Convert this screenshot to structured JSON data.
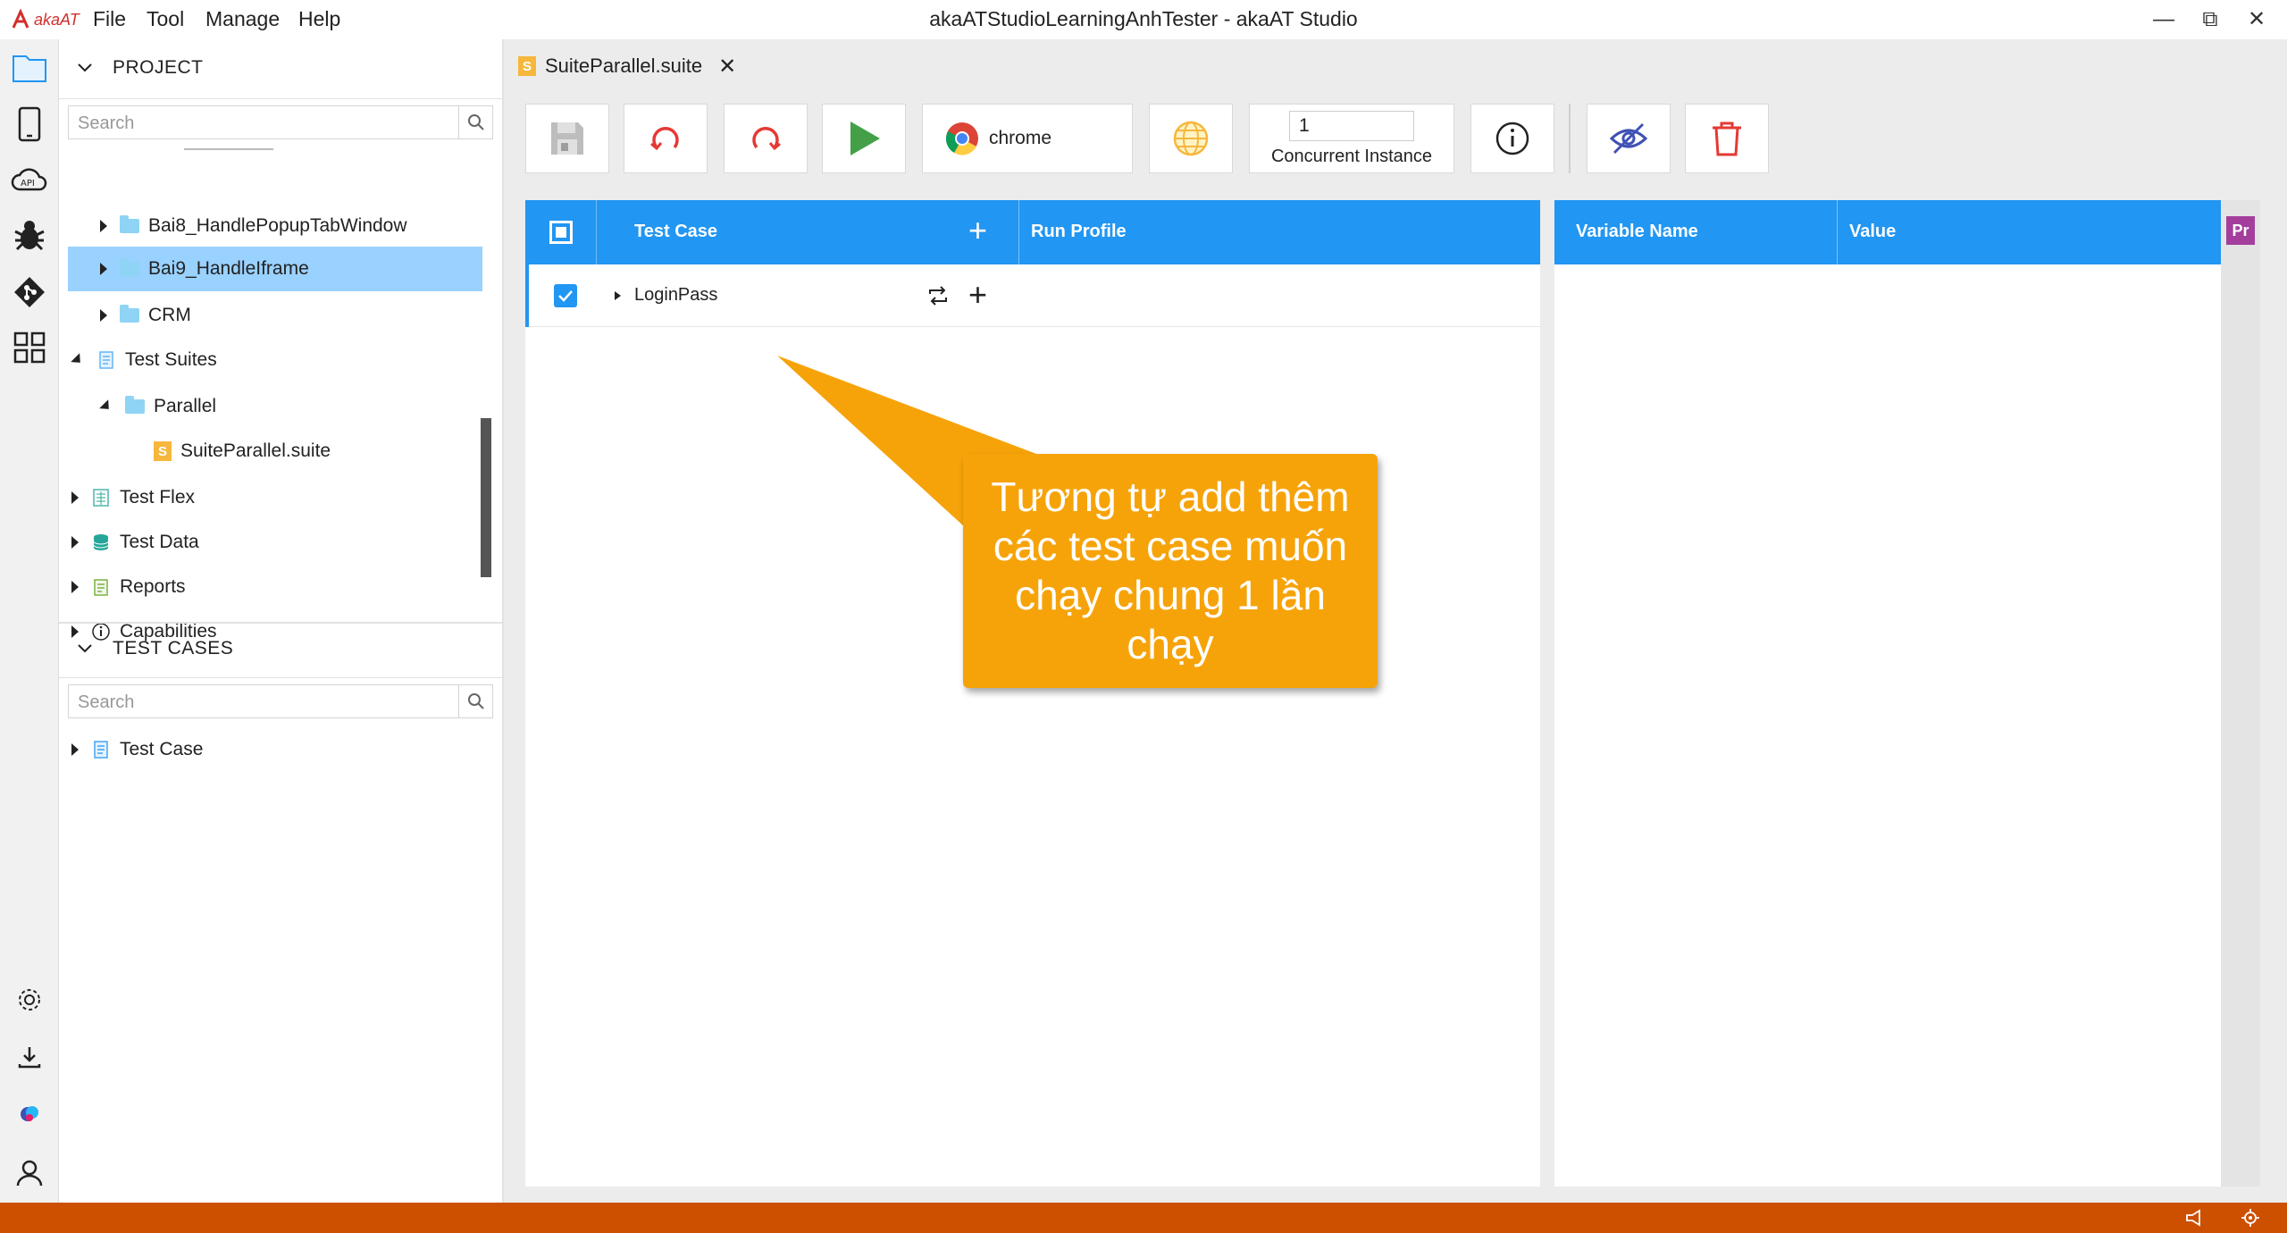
{
  "app": {
    "logo_text": "akaAT",
    "window_title": "akaATStudioLearningAnhTester - akaAT Studio",
    "menu": [
      "File",
      "Tool",
      "Manage",
      "Help"
    ]
  },
  "project": {
    "header": "PROJECT",
    "search_placeholder": "Search",
    "tree": [
      {
        "label": "Bai8_HandlePopupTabWindow"
      },
      {
        "label": "Bai9_HandleIframe"
      },
      {
        "label": "CRM"
      },
      {
        "label": "Test Suites"
      },
      {
        "label": "Parallel"
      },
      {
        "label": "SuiteParallel.suite"
      },
      {
        "label": "Test Flex"
      },
      {
        "label": "Test Data"
      },
      {
        "label": "Reports"
      },
      {
        "label": "Capabilities"
      }
    ]
  },
  "testcases": {
    "header": "TEST CASES",
    "search_placeholder": "Search",
    "tree": [
      {
        "label": "Test Case"
      }
    ]
  },
  "editor": {
    "tab_label": "SuiteParallel.suite",
    "browser_label": "chrome",
    "concurrent_value": "1",
    "concurrent_label": "Concurrent Instance",
    "grid": {
      "col_test_case": "Test Case",
      "col_run_profile": "Run Profile",
      "col_variable_name": "Variable Name",
      "col_value": "Value",
      "side_badge": "Pr",
      "rows": [
        {
          "name": "LoginPass",
          "checked": true
        }
      ]
    }
  },
  "callout": {
    "text": "Tương tự add thêm các test case muốn chạy chung 1 lần chạy"
  },
  "colors": {
    "accent": "#2196f3",
    "status_bar": "#cc5000",
    "callout": "#f6a30a",
    "selection": "#99d1ff"
  }
}
